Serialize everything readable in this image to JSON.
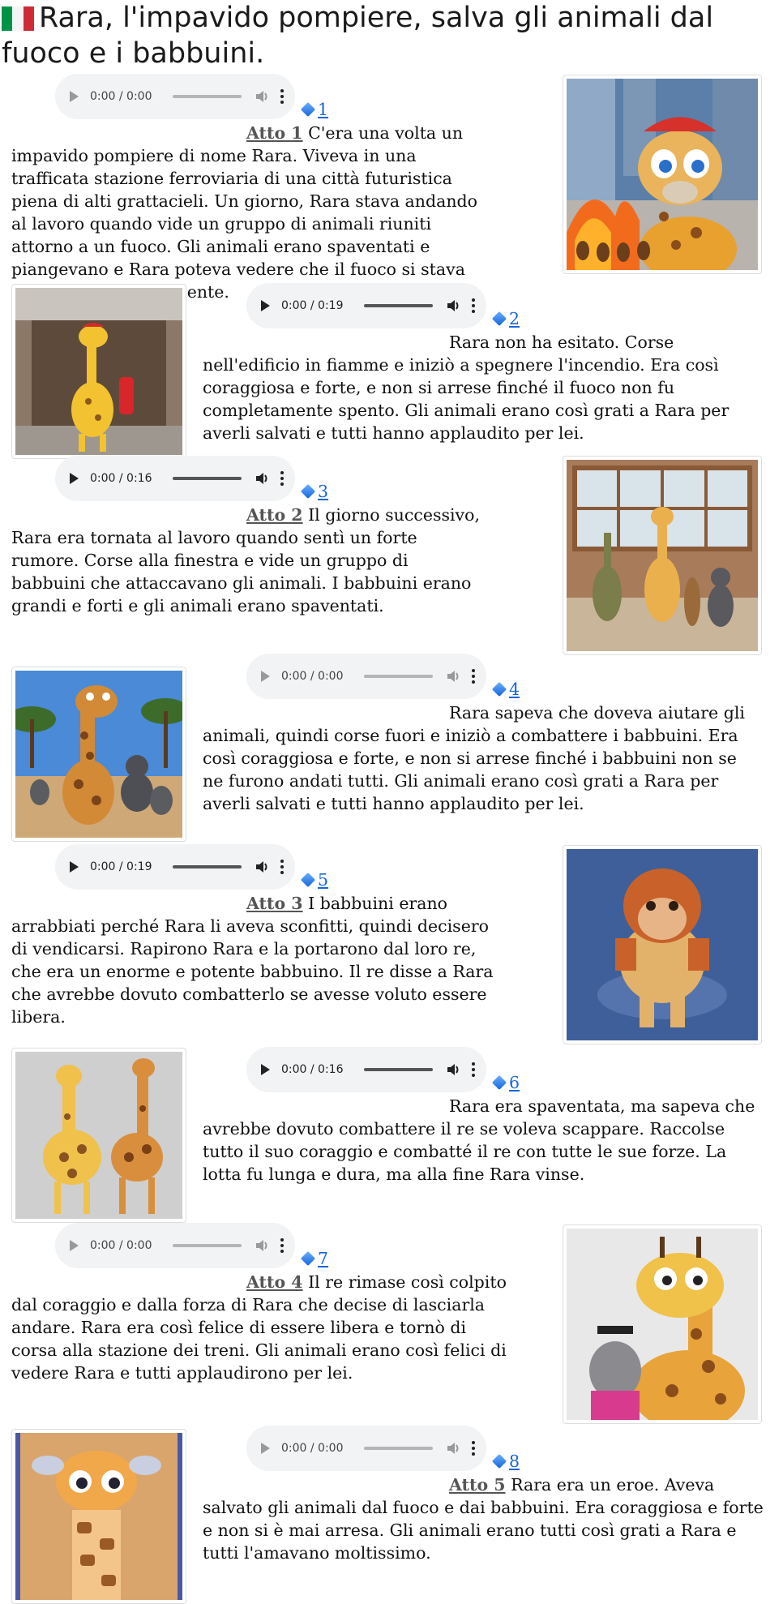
{
  "page": {
    "title": "Rara, l'impavido pompiere, salva gli animali dal fuoco e i babbuini.",
    "flag_icon": "italy-flag-icon"
  },
  "sections": [
    {
      "num": "1",
      "act": "Atto 1",
      "time": "0:00 / 0:00",
      "enabled": false,
      "text": " C'era una volta un impavido pompiere di nome Rara. Viveva in una trafficata stazione ferroviaria di una città futuristica piena di alti grattacieli. Un giorno, Rara stava andando al lavoro quando vide un gruppo di animali riuniti attorno a un fuoco. Gli animali erano spaventati e piangevano e Rara poteva vedere che il fuoco si stava diffondendo rapidamente."
    },
    {
      "num": "2",
      "act": "",
      "time": "0:00 / 0:19",
      "enabled": true,
      "text": "Rara non ha esitato. Corse nell'edificio in fiamme e iniziò a spegnere l'incendio. Era così coraggiosa e forte, e non si arrese finché il fuoco non fu completamente spento. Gli animali erano così grati a Rara per averli salvati e tutti hanno applaudito per lei."
    },
    {
      "num": "3",
      "act": "Atto 2",
      "time": "0:00 / 0:16",
      "enabled": true,
      "text": " Il giorno successivo, Rara era tornata al lavoro quando sentì un forte rumore. Corse alla finestra e vide un gruppo di babbuini che attaccavano gli animali. I babbuini erano grandi e forti e gli animali erano spaventati."
    },
    {
      "num": "4",
      "act": "",
      "time": "0:00 / 0:00",
      "enabled": false,
      "text": "Rara sapeva che doveva aiutare gli animali, quindi corse fuori e iniziò a combattere i babbuini. Era così coraggiosa e forte, e non si arrese finché i babbuini non se ne furono andati tutti. Gli animali erano così grati a Rara per averli salvati e tutti hanno applaudito per lei."
    },
    {
      "num": "5",
      "act": "Atto 3",
      "time": "0:00 / 0:19",
      "enabled": true,
      "text": " I babbuini erano arrabbiati perché Rara li aveva sconfitti, quindi decisero di vendicarsi. Rapirono Rara e la portarono dal loro re, che era un enorme e potente babbuino. Il re disse a Rara che avrebbe dovuto combatterlo se avesse voluto essere libera."
    },
    {
      "num": "6",
      "act": "",
      "time": "0:00 / 0:16",
      "enabled": true,
      "text": "Rara era spaventata, ma sapeva che avrebbe dovuto combattere il re se voleva scappare. Raccolse tutto il suo coraggio e combatté il re con tutte le sue forze. La lotta fu lunga e dura, ma alla fine Rara vinse."
    },
    {
      "num": "7",
      "act": "Atto 4",
      "time": "0:00 / 0:00",
      "enabled": false,
      "text": " Il re rimase così colpito dal coraggio e dalla forza di Rara che decise di lasciarla andare. Rara era così felice di essere libera e tornò di corsa alla stazione dei treni. Gli animali erano così felici di vedere Rara e tutti applaudirono per lei."
    },
    {
      "num": "8",
      "act": "Atto 5",
      "time": "0:00 / 0:00",
      "enabled": false,
      "text": " Rara era un eroe. Aveva salvato gli animali dal fuoco e dai babbuini. Era coraggiosa e forte e non si è mai arresa. Gli animali erano tutti così grati a Rara e tutti l'amavano moltissimo."
    }
  ],
  "icons": {
    "number": "blue-diamond-icon",
    "play": "play-icon",
    "volume": "volume-icon",
    "menu": "more-options-icon"
  }
}
